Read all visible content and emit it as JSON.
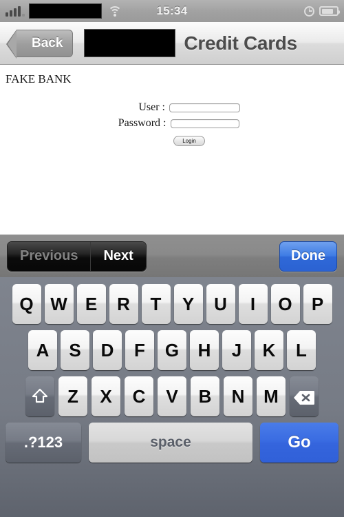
{
  "status_bar": {
    "carrier_redacted": true,
    "signal_icon": "signal-bars-icon",
    "wifi_icon": "wifi-icon",
    "time": "15:34",
    "alarm_icon": "alarm-clock-icon",
    "battery_icon": "battery-icon",
    "battery_level_pct": 78
  },
  "nav_bar": {
    "back_label": "Back",
    "title": "Credit Cards",
    "title_redacted": true
  },
  "content": {
    "bank_title": "FAKE BANK",
    "fields": [
      {
        "label": "User :",
        "value": "",
        "placeholder": "",
        "name": "user-field"
      },
      {
        "label": "Password :",
        "value": "",
        "placeholder": "",
        "name": "password-field"
      }
    ],
    "login_label": "Login"
  },
  "keyboard_toolbar": {
    "previous_label": "Previous",
    "previous_enabled": false,
    "next_label": "Next",
    "next_enabled": true,
    "done_label": "Done",
    "done_color": "#3a6cdc"
  },
  "keyboard": {
    "shift_active": true,
    "row1": [
      "Q",
      "W",
      "E",
      "R",
      "T",
      "Y",
      "U",
      "I",
      "O",
      "P"
    ],
    "row2": [
      "A",
      "S",
      "D",
      "F",
      "G",
      "H",
      "J",
      "K",
      "L"
    ],
    "row3": [
      "Z",
      "X",
      "C",
      "V",
      "B",
      "N",
      "M"
    ],
    "shift_icon": "shift-up-arrow-icon",
    "backspace_icon": "backspace-delete-icon",
    "numeric_label": ".?123",
    "space_label": "space",
    "return_label": "Go",
    "return_color": "#3a6ce2"
  }
}
